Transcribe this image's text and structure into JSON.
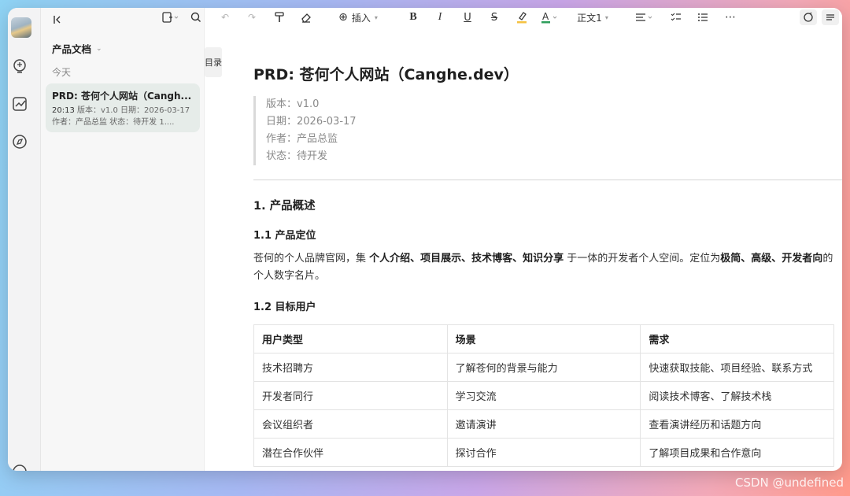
{
  "sidebar": {
    "folder_title": "产品文档",
    "section_label": "今天",
    "doc": {
      "title": "PRD: 苍何个人网站（Cangh...",
      "time": "20:13",
      "meta": "版本：v1.0 日期：2026-03-17 作者：产品总监 状态：待开发 1...."
    }
  },
  "toolbar": {
    "insert_label": "插入",
    "style_label": "正文1"
  },
  "toc_tab": "目录",
  "document": {
    "title": "PRD: 苍何个人网站（Canghe.dev）",
    "meta": [
      "版本：v1.0",
      "日期：2026-03-17",
      "作者：产品总监",
      "状态：待开发"
    ],
    "h_overview": "1. 产品概述",
    "h_positioning": "1.1 产品定位",
    "para": {
      "p1": "苍何的个人品牌官网，集 ",
      "b1": "个人介绍、项目展示、技术博客、知识分享",
      "p2": " 于一体的开发者个人空间。定位为",
      "b2": "极简、高级、开发者向",
      "p3": "的个人数字名片。"
    },
    "h_users": "1.2 目标用户",
    "table": {
      "headers": [
        "用户类型",
        "场景",
        "需求"
      ],
      "rows": [
        [
          "技术招聘方",
          "了解苍何的背景与能力",
          "快速获取技能、项目经验、联系方式"
        ],
        [
          "开发者同行",
          "学习交流",
          "阅读技术博客、了解技术栈"
        ],
        [
          "会议组织者",
          "邀请演讲",
          "查看演讲经历和话题方向"
        ],
        [
          "潜在合作伙伴",
          "探讨合作",
          "了解项目成果和合作意向"
        ]
      ]
    }
  },
  "watermark": "CSDN @undefined",
  "colors": {
    "font_color_underline": "#2e9e5b",
    "highlight": "#f5c242"
  }
}
